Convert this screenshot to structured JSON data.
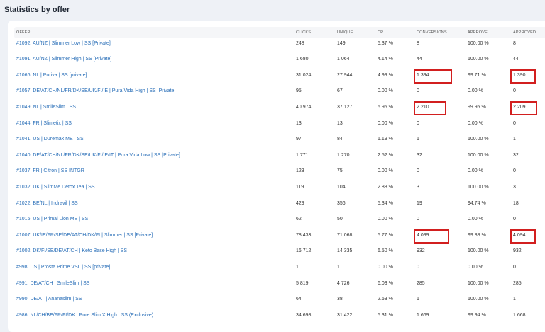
{
  "page": {
    "title": "Statistics by offer"
  },
  "table": {
    "columns": [
      "OFFER",
      "CLICKS",
      "UNIQUE",
      "CR",
      "CONVERSIONS",
      "APPROVE",
      "APPROVED"
    ],
    "rows": [
      [
        "#1092: AU/NZ | Slimmer Low | SS [Private]",
        "248",
        "149",
        "5.37 %",
        "8",
        "100.00 %",
        "8"
      ],
      [
        "#1091: AU/NZ | Slimmer High | SS [Private]",
        "1 680",
        "1 064",
        "4.14 %",
        "44",
        "100.00 %",
        "44"
      ],
      [
        "#1066: NL | Puriva | SS [private]",
        "31 024",
        "27 944",
        "4.99 %",
        "1 394",
        "99.71 %",
        "1 390"
      ],
      [
        "#1057: DE/AT/CH/NL/FR/DK/SE/UK/FI/IE | Pura Vida High | SS [Private]",
        "95",
        "67",
        "0.00 %",
        "0",
        "0.00 %",
        "0"
      ],
      [
        "#1049: NL | SmileSlim | SS",
        "40 974",
        "37 127",
        "5.95 %",
        "2 210",
        "99.95 %",
        "2 209"
      ],
      [
        "#1044: FR | Slimetix | SS",
        "13",
        "13",
        "0.00 %",
        "0",
        "0.00 %",
        "0"
      ],
      [
        "#1041: US | Duremax ME | SS",
        "97",
        "84",
        "1.19 %",
        "1",
        "100.00 %",
        "1"
      ],
      [
        "#1040: DE/AT/CH/NL/FR/DK/SE/UK/FI/IE/IT | Pura Vida Low | SS [Private]",
        "1 771",
        "1 270",
        "2.52 %",
        "32",
        "100.00 %",
        "32"
      ],
      [
        "#1037: FR | Citron | SS INTGR",
        "123",
        "75",
        "0.00 %",
        "0",
        "0.00 %",
        "0"
      ],
      [
        "#1032: UK | SlimMe Detox Tea | SS",
        "119",
        "104",
        "2.88 %",
        "3",
        "100.00 %",
        "3"
      ],
      [
        "#1022: BE/NL | Indravil | SS",
        "429",
        "356",
        "5.34 %",
        "19",
        "94.74 %",
        "18"
      ],
      [
        "#1016: US | Primal Lion ME | SS",
        "62",
        "50",
        "0.00 %",
        "0",
        "0.00 %",
        "0"
      ],
      [
        "#1007: UK/IE/FR/SE/DE/AT/CH/DK/FI | Slimmer | SS [Private]",
        "78 433",
        "71 068",
        "5.77 %",
        "4 099",
        "99.88 %",
        "4 094"
      ],
      [
        "#1002: DK/FI/SE/DE/AT/CH | Keto Base High | SS",
        "16 712",
        "14 335",
        "6.50 %",
        "932",
        "100.00 %",
        "932"
      ],
      [
        "#998: US | Prosta Prime VSL | SS [private]",
        "1",
        "1",
        "0.00 %",
        "0",
        "0.00 %",
        "0"
      ],
      [
        "#991: DE/AT/CH | SmileSlim | SS",
        "5 819",
        "4 726",
        "6.03 %",
        "285",
        "100.00 %",
        "285"
      ],
      [
        "#990: DE/AT | Ananaslim | SS",
        "64",
        "38",
        "2.63 %",
        "1",
        "100.00 %",
        "1"
      ],
      [
        "#986: NL/CH/BE/FR/FI/DK | Pure Slim X High | SS (Exclusive)",
        "34 698",
        "31 422",
        "5.31 %",
        "1 669",
        "99.94 %",
        "1 668"
      ]
    ]
  },
  "highlight_color": "#d21f1f"
}
